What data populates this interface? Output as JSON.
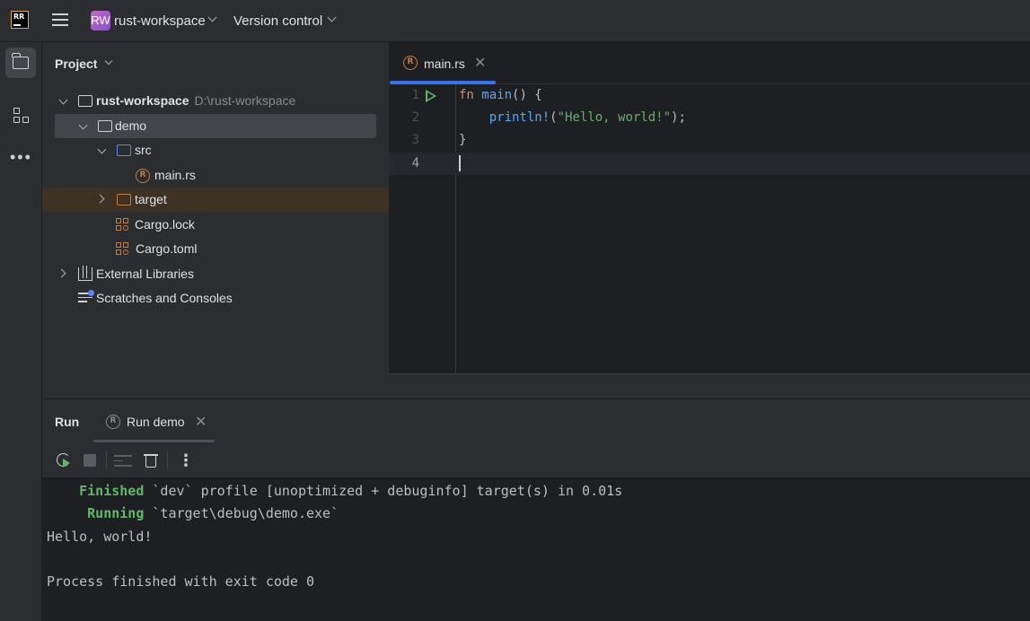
{
  "titlebar": {
    "logo_text": "RR",
    "project_badge": "RW",
    "project_name": "rust-workspace",
    "vcs_label": "Version control"
  },
  "project_panel": {
    "title": "Project",
    "tree": [
      {
        "label": "rust-workspace",
        "path": "D:\\rust-workspace",
        "icon": "folder-icon"
      },
      {
        "label": "demo",
        "icon": "folder-icon"
      },
      {
        "label": "src",
        "icon": "source-folder-icon"
      },
      {
        "label": "main.rs",
        "icon": "rust-file-icon"
      },
      {
        "label": "target",
        "icon": "excluded-folder-icon"
      },
      {
        "label": "Cargo.lock",
        "icon": "cargo-lock-icon"
      },
      {
        "label": "Cargo.toml",
        "icon": "cargo-toml-icon"
      },
      {
        "label": "External Libraries",
        "icon": "library-icon"
      },
      {
        "label": "Scratches and Consoles",
        "icon": "scratches-icon"
      }
    ]
  },
  "editor": {
    "tab_label": "main.rs",
    "line_numbers": [
      "1",
      "2",
      "3",
      "4"
    ],
    "code": {
      "l1_kw": "fn",
      "l1_fn": "main",
      "l1_rest": "() {",
      "l2_indent": "    ",
      "l2_macro": "println!",
      "l2_open": "(",
      "l2_str": "\"Hello, world!\"",
      "l2_close": ");",
      "l3": "}"
    }
  },
  "run_panel": {
    "title": "Run",
    "tab_label": "Run demo",
    "console": {
      "line1_status": "Finished",
      "line1_text": " `dev` profile [unoptimized + debuginfo] target(s) in 0.01s",
      "line2_status": "Running",
      "line2_text": " `target\\debug\\demo.exe`",
      "line3": "Hello, world!",
      "line5": "Process finished with exit code 0"
    }
  },
  "colors": {
    "accent": "#3574f0",
    "run_green": "#5fb865",
    "rust_orange": "#c77c3c",
    "background": "#1e1f22",
    "panel": "#2b2d30"
  }
}
